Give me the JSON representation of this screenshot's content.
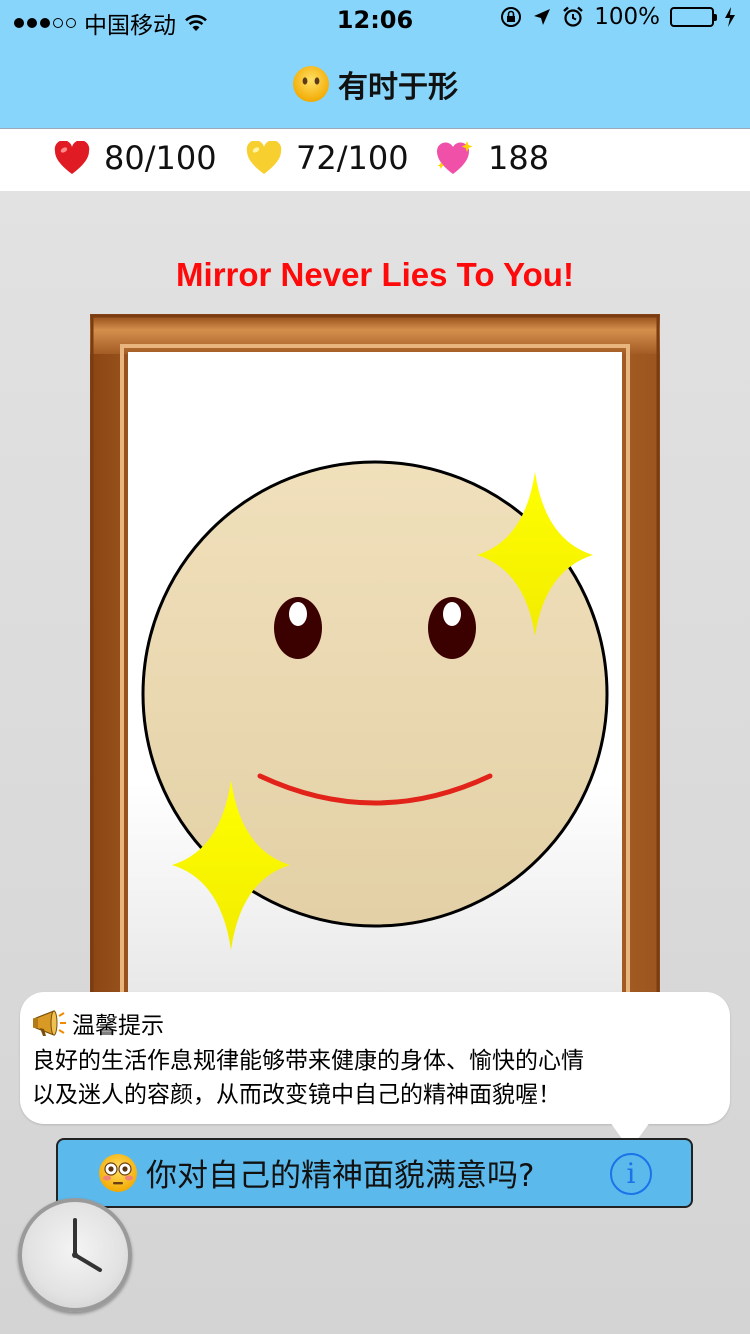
{
  "status_bar": {
    "carrier": "中国移动",
    "time": "12:06",
    "battery": "100%",
    "signal_bars_filled": 3,
    "signal_bars_total": 5
  },
  "nav": {
    "title": "有时于形",
    "title_icon": "speechless-face-icon"
  },
  "stats": [
    {
      "icon": "red-heart-icon",
      "value": "80/100"
    },
    {
      "icon": "yellow-heart-icon",
      "value": "72/100"
    },
    {
      "icon": "sparkling-heart-icon",
      "value": "188"
    }
  ],
  "mirror": {
    "heading": "Mirror Never Lies To You!"
  },
  "tip": {
    "title": "温馨提示",
    "title_icon": "megaphone-icon",
    "line1": "良好的生活作息规律能够带来健康的身体、愉快的心情",
    "line2": "以及迷人的容颜，从而改变镜中自己的精神面貌喔！"
  },
  "question": {
    "icon": "flushed-face-icon",
    "text": "你对自己的精神面貌满意吗?",
    "info_label": "i"
  },
  "colors": {
    "bar_blue": "#88d5fb",
    "heading_red": "#ff0a0a",
    "face_skin": "#efdfb8",
    "smile_red": "#e2231a",
    "sparkle_yellow": "#ffff00",
    "question_bg": "#5cb9ec",
    "info_blue": "#1a73e8"
  }
}
